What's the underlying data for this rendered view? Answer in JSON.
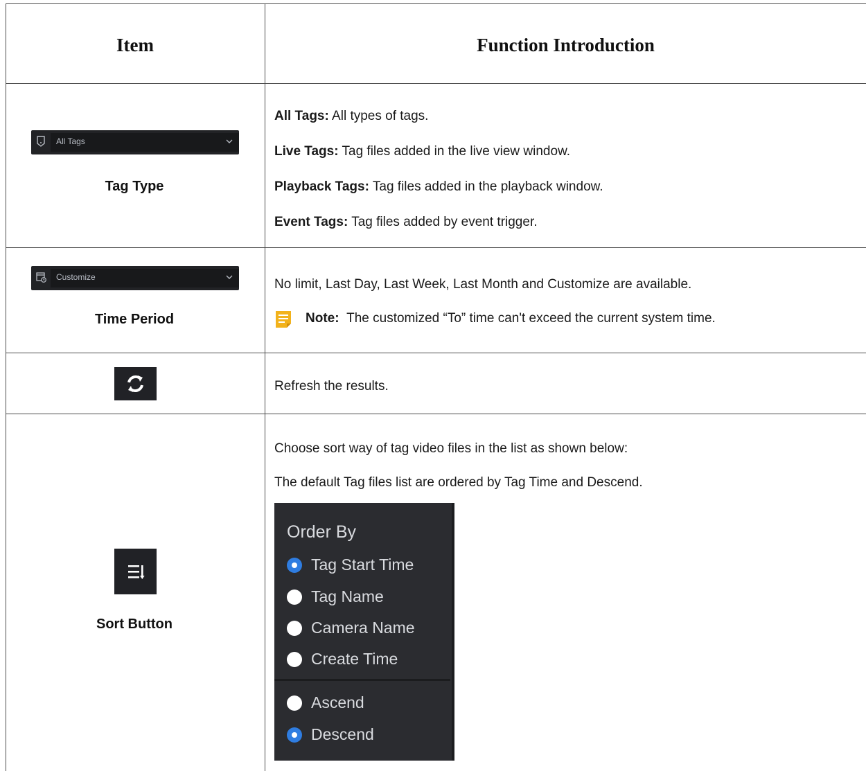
{
  "table": {
    "headers": {
      "item": "Item",
      "function": "Function Introduction"
    },
    "rows": {
      "tag_type": {
        "dropdown_value": "All Tags",
        "label": "Tag Type",
        "lines": [
          {
            "term": "All Tags:",
            "text": " All types of tags."
          },
          {
            "term": "Live Tags:",
            "text": " Tag files added in the live view window."
          },
          {
            "term": "Playback Tags:",
            "text": " Tag files added in the playback window."
          },
          {
            "term": "Event Tags:",
            "text": " Tag files added by event trigger."
          }
        ]
      },
      "time_period": {
        "dropdown_value": "Customize",
        "label": "Time Period",
        "text": "No limit, Last Day, Last Week, Last Month and Customize are available.",
        "note_label": "Note:",
        "note_text": "The customized “To” time can't exceed the current system time."
      },
      "refresh": {
        "icon": "refresh-icon",
        "text": "Refresh the results."
      },
      "sort": {
        "label": "Sort Button",
        "icon": "sort-icon",
        "line1": "Choose sort way of tag video files in the list as shown below:",
        "line2": "The default Tag files list are ordered by Tag Time and Descend.",
        "popup": {
          "title": "Order By",
          "options": [
            "Tag Start Time",
            "Tag Name",
            "Camera Name",
            "Create Time"
          ],
          "selected_option": "Tag Start Time",
          "orders": [
            "Ascend",
            "Descend"
          ],
          "selected_order": "Descend"
        }
      }
    }
  },
  "colors": {
    "accent": "#2f7de1",
    "dark_panel": "#2b2c30",
    "note_yellow": "#f2b21b"
  }
}
